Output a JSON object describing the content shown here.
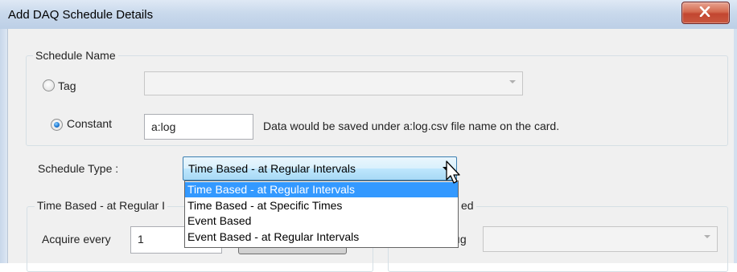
{
  "dialog": {
    "title": "Add DAQ Schedule Details"
  },
  "schedule_name": {
    "legend": "Schedule Name",
    "tag_label": "Tag",
    "tag_selected": false,
    "tag_value": "",
    "constant_label": "Constant",
    "constant_selected": true,
    "constant_value": "a:log",
    "info_text": "Data would be saved under a:log.csv file name on the card."
  },
  "schedule_type": {
    "label": "Schedule Type :",
    "selected": "Time Based - at Regular Intervals",
    "options": [
      "Time Based - at Regular Intervals",
      "Time Based - at Specific Times",
      "Event Based",
      "Event Based - at Regular Intervals"
    ],
    "dropdown_open": true
  },
  "time_group": {
    "legend": "Time Based - at Regular I",
    "acquire_label": "Acquire every",
    "acquire_value": "1"
  },
  "event_group": {
    "legend": "ed",
    "tag_label": "ıg",
    "tag_value": ""
  },
  "colors": {
    "selection": "#3399ff",
    "titlebar": "#c9d9ec",
    "close_button": "#c24630",
    "dialog_background": "#f0f0f0"
  }
}
